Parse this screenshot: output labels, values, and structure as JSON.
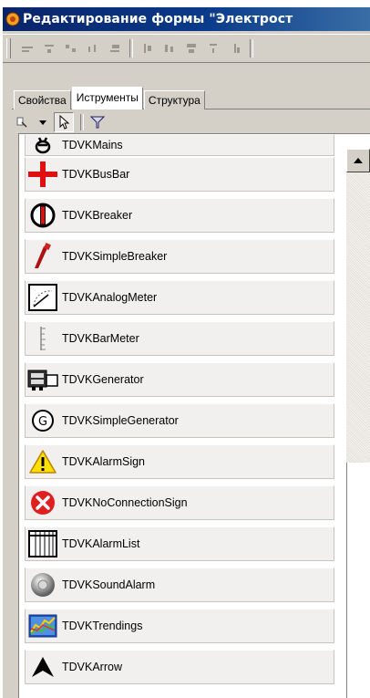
{
  "window": {
    "title": "Редактирование формы \"Электрост"
  },
  "tabs": [
    {
      "label": "Свойства",
      "active": false
    },
    {
      "label": "Иструменты",
      "active": true
    },
    {
      "label": "Структура",
      "active": false
    }
  ],
  "toolbox": {
    "items": [
      {
        "label": "TDVKMains",
        "icon": "mains-symbol-icon"
      },
      {
        "label": "TDVKBusBar",
        "icon": "busbar-icon"
      },
      {
        "label": "TDVKBreaker",
        "icon": "breaker-icon"
      },
      {
        "label": "TDVKSimpleBreaker",
        "icon": "simple-breaker-icon"
      },
      {
        "label": "TDVKAnalogMeter",
        "icon": "analog-meter-icon"
      },
      {
        "label": "TDVKBarMeter",
        "icon": "bar-meter-icon"
      },
      {
        "label": "TDVKGenerator",
        "icon": "generator-icon"
      },
      {
        "label": "TDVKSimpleGenerator",
        "icon": "simple-generator-icon"
      },
      {
        "label": "TDVKAlarmSign",
        "icon": "warning-triangle-icon"
      },
      {
        "label": "TDVKNoConnectionSign",
        "icon": "no-connection-icon"
      },
      {
        "label": "TDVKAlarmList",
        "icon": "alarm-list-icon"
      },
      {
        "label": "TDVKSoundAlarm",
        "icon": "sound-alarm-icon"
      },
      {
        "label": "TDVKTrendings",
        "icon": "trend-chart-icon"
      },
      {
        "label": "TDVKArrow",
        "icon": "arrow-icon"
      }
    ]
  },
  "colors": {
    "title_bar": "#0a246a",
    "face": "#d4d0c8",
    "busbar_red": "#e01010",
    "warning_yellow": "#ffe000",
    "error_red": "#e02020"
  }
}
